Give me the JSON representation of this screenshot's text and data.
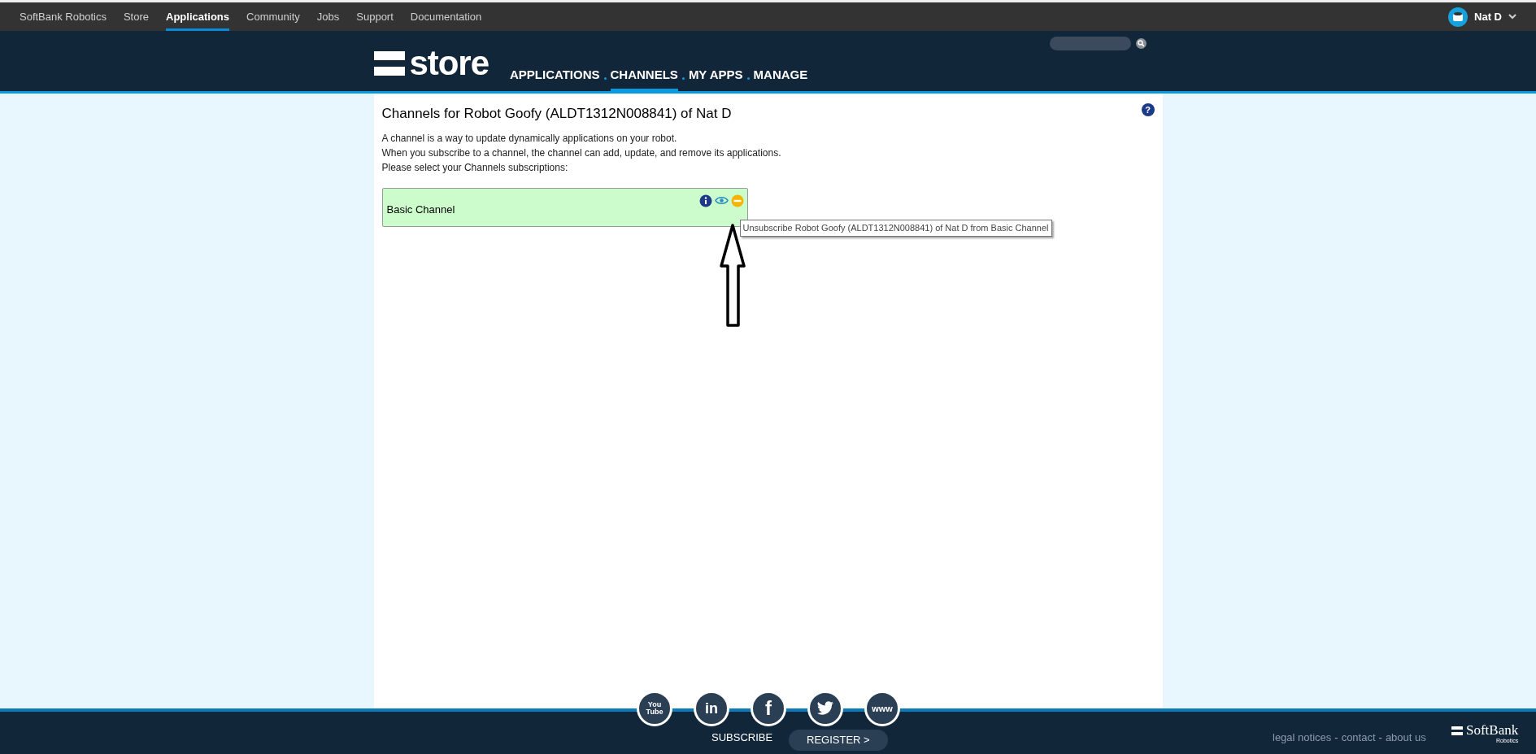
{
  "top_nav": {
    "items": [
      {
        "label": "SoftBank Robotics",
        "selected": false
      },
      {
        "label": "Store",
        "selected": false
      },
      {
        "label": "Applications",
        "selected": true
      },
      {
        "label": "Community",
        "selected": false
      },
      {
        "label": "Jobs",
        "selected": false
      },
      {
        "label": "Support",
        "selected": false
      },
      {
        "label": "Documentation",
        "selected": false
      }
    ],
    "user": {
      "name": "Nat D"
    }
  },
  "header": {
    "logo": "store",
    "nav": [
      {
        "label": "APPLICATIONS",
        "selected": false
      },
      {
        "label": "CHANNELS",
        "selected": true
      },
      {
        "label": "MY APPS",
        "selected": false
      },
      {
        "label": "MANAGE",
        "selected": false
      }
    ]
  },
  "content": {
    "title": "Channels for Robot Goofy (ALDT1312N008841) of Nat D",
    "description": [
      "A channel is a way to update dynamically applications on your robot.",
      "When you subscribe to a channel, the channel can add, update, and remove its applications.",
      "Please select your Channels subscriptions:"
    ],
    "channels": [
      {
        "name": "Basic Channel",
        "subscribed": true
      }
    ],
    "help": "?",
    "tooltip": "Unsubscribe Robot Goofy (ALDT1312N008841) of Nat D from Basic Channel"
  },
  "footer": {
    "social": [
      {
        "kind": "youtube",
        "label": "You Tube"
      },
      {
        "kind": "linkedin",
        "label": "in"
      },
      {
        "kind": "facebook",
        "label": "f"
      },
      {
        "kind": "twitter"
      },
      {
        "kind": "web",
        "label": "www"
      }
    ],
    "subscribe": "SUBSCRIBE",
    "register": "REGISTER >",
    "links": [
      "legal notices",
      "contact",
      "about us"
    ],
    "separator": "-",
    "brand": "SoftBank",
    "brand_sub": "Robotics"
  }
}
